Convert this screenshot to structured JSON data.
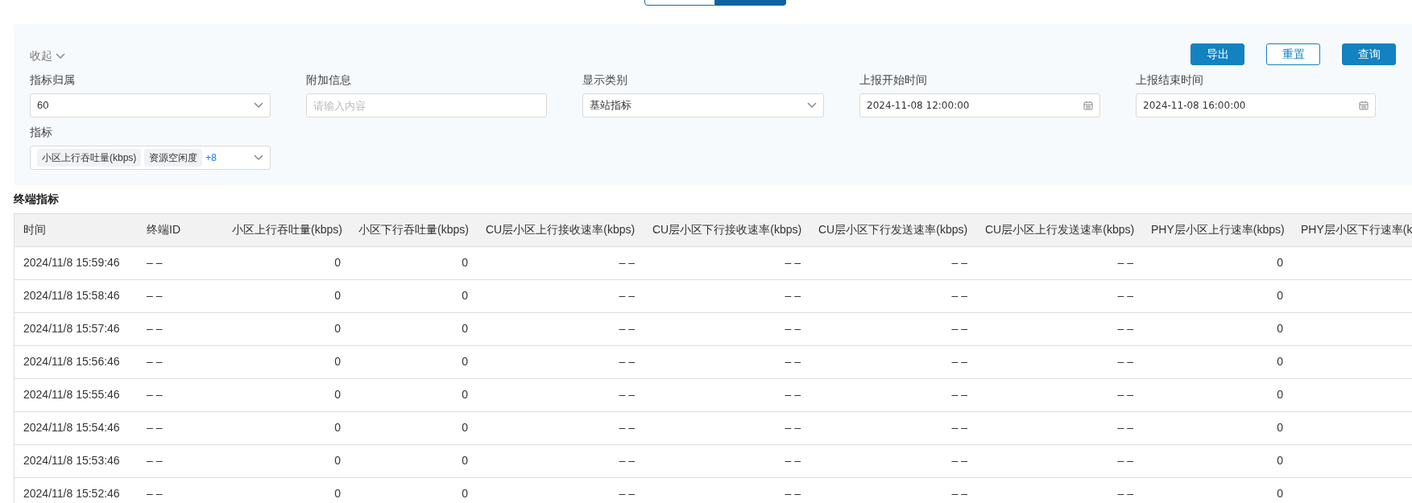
{
  "collapse_toggle": {
    "label": "收起",
    "expanded": true
  },
  "buttons": [
    {
      "label": "导出",
      "kind": "primary"
    },
    {
      "label": "重置",
      "kind": "outline"
    },
    {
      "label": "查询",
      "kind": "primary"
    }
  ],
  "filters": [
    {
      "label": "指标归属",
      "kind": "select",
      "value": "60"
    },
    {
      "label": "附加信息",
      "kind": "input",
      "placeholder": "请输入内容"
    },
    {
      "label": "显示类别",
      "kind": "select",
      "value": "基站指标"
    },
    {
      "label": "上报开始时间",
      "kind": "date",
      "value": "2024-11-08 12:00:00"
    },
    {
      "label": "上报结束时间",
      "kind": "date",
      "value": "2024-11-08 16:00:00"
    },
    {
      "label": "指标",
      "kind": "tags",
      "tags": [
        "小区上行吞吐量(kbps)",
        "资源空闲度"
      ],
      "more": "+8"
    }
  ],
  "section_title": "终端指标",
  "table": {
    "columns": [
      "时间",
      "终端ID",
      "小区上行吞吐量(kbps)",
      "小区下行吞吐量(kbps)",
      "CU层小区上行接收速率(kbps)",
      "CU层小区下行接收速率(kbps)",
      "CU层小区下行发送速率(kbps)",
      "CU层小区上行发送速率(kbps)",
      "PHY层小区上行速率(kbps)",
      "PHY层小区下行速率(k"
    ],
    "rows": [
      [
        "2024/11/8 15:59:46",
        "– –",
        "0",
        "0",
        "– –",
        "– –",
        "– –",
        "– –",
        "0"
      ],
      [
        "2024/11/8 15:58:46",
        "– –",
        "0",
        "0",
        "– –",
        "– –",
        "– –",
        "– –",
        "0"
      ],
      [
        "2024/11/8 15:57:46",
        "– –",
        "0",
        "0",
        "– –",
        "– –",
        "– –",
        "– –",
        "0"
      ],
      [
        "2024/11/8 15:56:46",
        "– –",
        "0",
        "0",
        "– –",
        "– –",
        "– –",
        "– –",
        "0"
      ],
      [
        "2024/11/8 15:55:46",
        "– –",
        "0",
        "0",
        "– –",
        "– –",
        "– –",
        "– –",
        "0"
      ],
      [
        "2024/11/8 15:54:46",
        "– –",
        "0",
        "0",
        "– –",
        "– –",
        "– –",
        "– –",
        "0"
      ],
      [
        "2024/11/8 15:53:46",
        "– –",
        "0",
        "0",
        "– –",
        "– –",
        "– –",
        "– –",
        "0"
      ],
      [
        "2024/11/8 15:52:46",
        "– –",
        "0",
        "0",
        "– –",
        "– –",
        "– –",
        "– –",
        "0"
      ]
    ]
  }
}
